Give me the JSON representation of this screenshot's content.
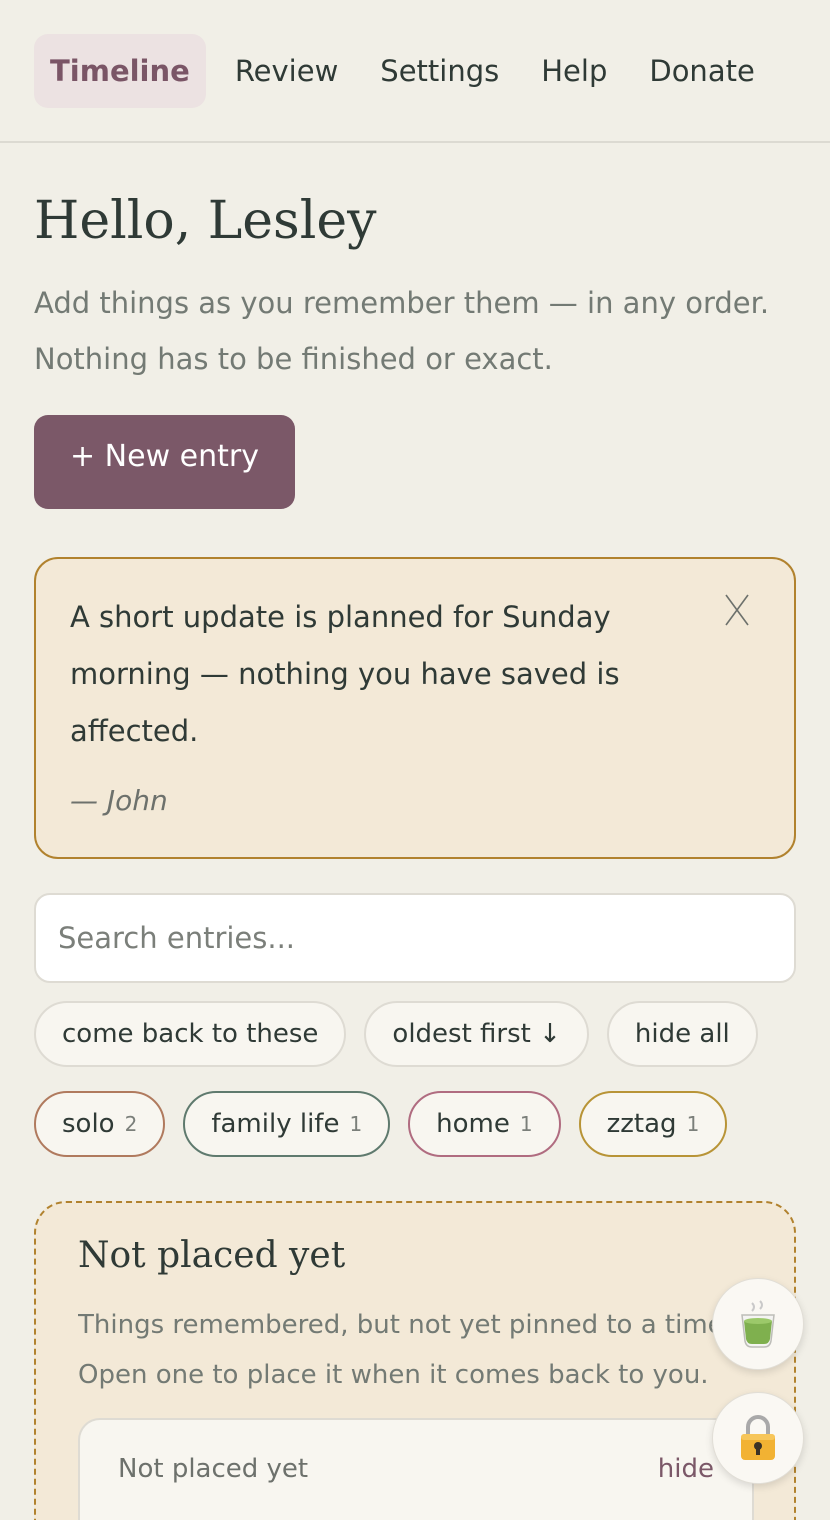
{
  "nav": {
    "items": [
      {
        "label": "Timeline",
        "active": true
      },
      {
        "label": "Review"
      },
      {
        "label": "Settings"
      },
      {
        "label": "Help"
      },
      {
        "label": "Donate"
      }
    ]
  },
  "greeting": "Hello, Lesley",
  "intro": {
    "line1": "Add things as you remember them — in any order.",
    "line2": "Nothing has to be finished or exact."
  },
  "new_entry_label": "+ New entry",
  "notice": {
    "text": "A short update is planned for Sunday morning — nothing you have saved is affected.",
    "signature": "— John",
    "close_icon": "close-x-icon"
  },
  "search": {
    "placeholder": "Search entries...",
    "value": ""
  },
  "filters": [
    {
      "label": "come back to these"
    },
    {
      "label": "oldest first ↓"
    },
    {
      "label": "hide all"
    }
  ],
  "tags": [
    {
      "name": "solo",
      "count": "2",
      "color": "#b07a5e"
    },
    {
      "name": "family life",
      "count": "1",
      "color": "#5f7a6e"
    },
    {
      "name": "home",
      "count": "1",
      "color": "#b06c80"
    },
    {
      "name": "zztag",
      "count": "1",
      "color": "#b89437"
    }
  ],
  "unplaced": {
    "title": "Not placed yet",
    "desc_line1": "Things remembered, but not yet pinned to a time.",
    "desc_line2": "Open one to place it when it comes back to you.",
    "subcard_title": "Not placed yet",
    "subcard_action": "hide"
  },
  "fabs": {
    "tea_icon": "tea-cup-icon",
    "lock_icon": "lock-icon"
  },
  "colors": {
    "accent": "#7b5868",
    "notice_border": "#b1822e",
    "background": "#f1efe7"
  }
}
